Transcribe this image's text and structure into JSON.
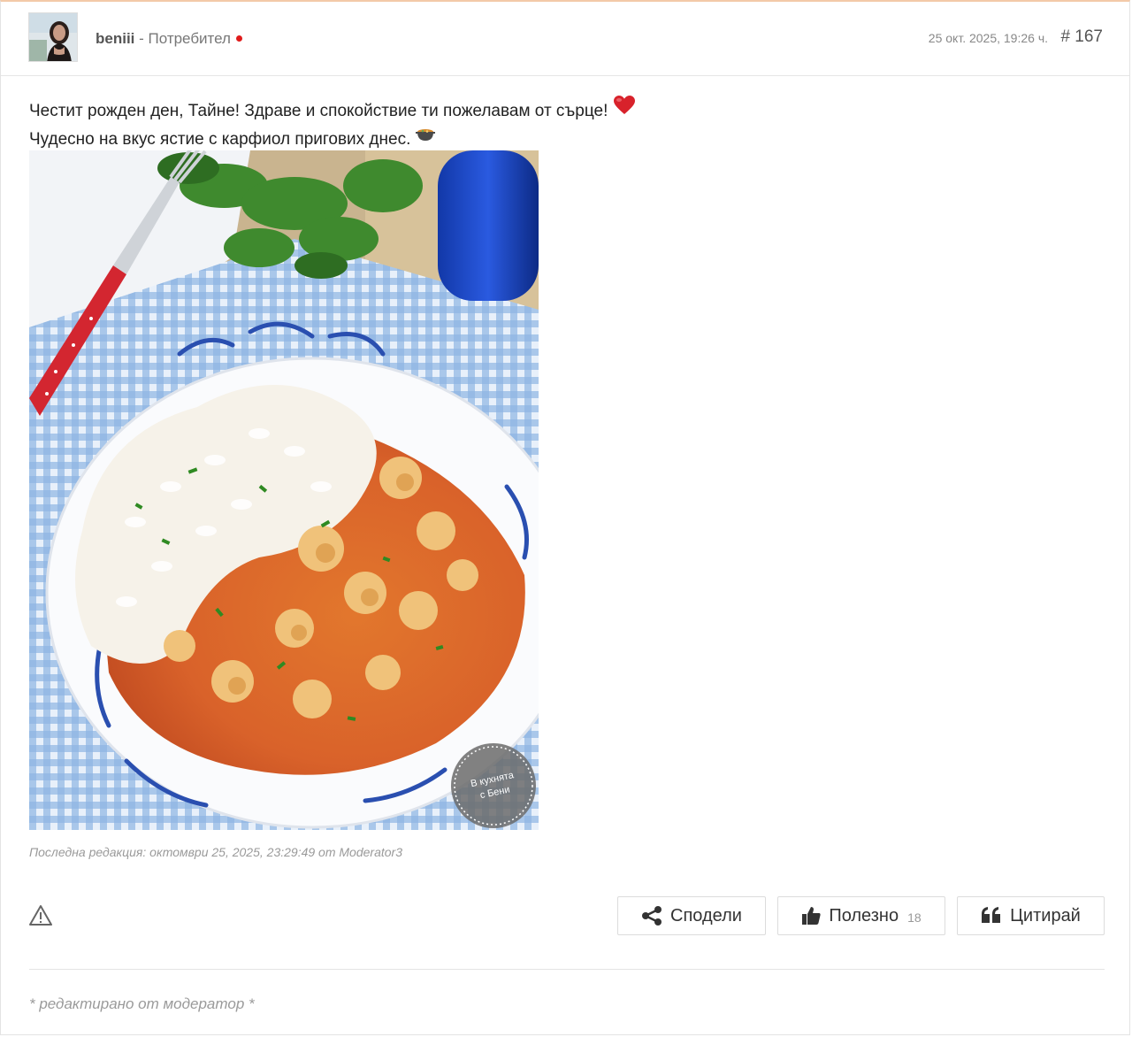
{
  "author": {
    "username": "beniii",
    "separator": " - ",
    "role": "Потребител",
    "online_status_color": "#e01b1b"
  },
  "post": {
    "date": "25 окт. 2025, 19:26 ч.",
    "number": "# 167",
    "lines": [
      "Честит рожден ден, Тайне! Здраве и спокойствие ти пожелавам от сърце!",
      "Чудесно на вкус ястие с карфиол пригових днес."
    ],
    "emojis": [
      "heart-emoji",
      "pot-of-food-emoji"
    ],
    "image": {
      "description_icon": "food-photo",
      "watermark_line1": "В кухнята",
      "watermark_line2": "с Бени"
    },
    "last_edit": "Последна редакция: октомври 25, 2025, 23:29:49 от Moderator3"
  },
  "actions": {
    "report_icon": "warning-triangle-icon",
    "share_label": "Сподели",
    "useful_label": "Полезно",
    "useful_count": "18",
    "quote_label": "Цитирай"
  },
  "footer": {
    "moderator_note": "* редактирано от модератор *"
  },
  "colors": {
    "accent_top_border": "#f3c9a8",
    "text": "#222222",
    "muted": "#9a9a9a"
  }
}
